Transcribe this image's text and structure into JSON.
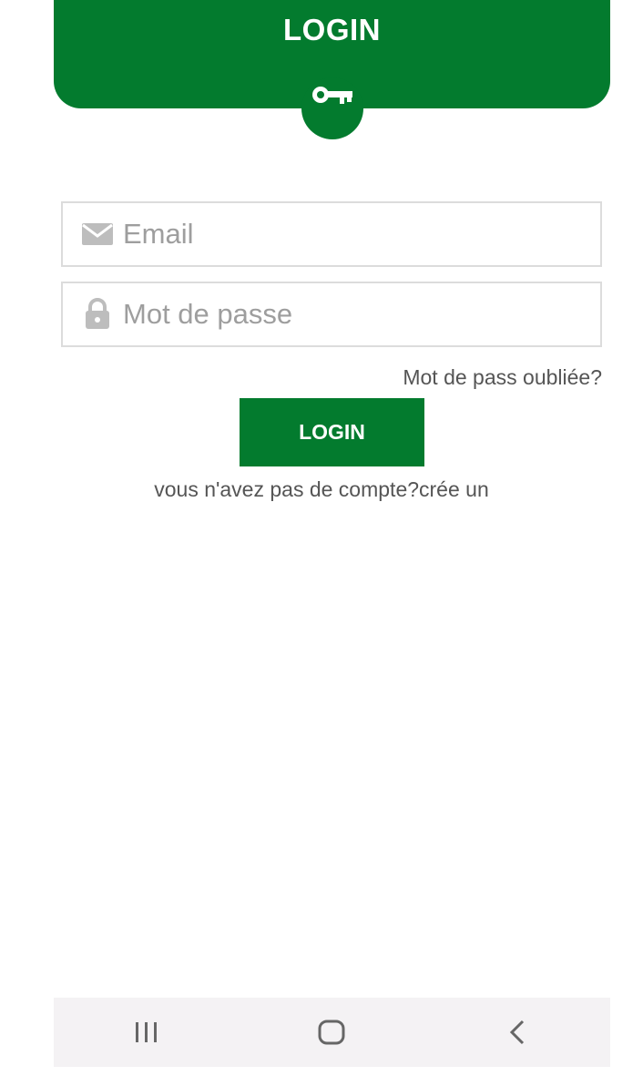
{
  "header": {
    "title": "LOGIN",
    "icon": "key-icon",
    "color": "#037B2E"
  },
  "form": {
    "email": {
      "icon": "mail-icon",
      "placeholder": "Email",
      "value": ""
    },
    "password": {
      "icon": "lock-icon",
      "placeholder": "Mot de passe",
      "value": ""
    },
    "forgot_label": "Mot de pass oubliée?",
    "login_label": "LOGIN",
    "signup_label": "vous n'avez pas de compte?crée un"
  },
  "navbar": {
    "items": [
      {
        "icon": "recent-apps-icon"
      },
      {
        "icon": "home-icon"
      },
      {
        "icon": "back-icon"
      }
    ]
  }
}
